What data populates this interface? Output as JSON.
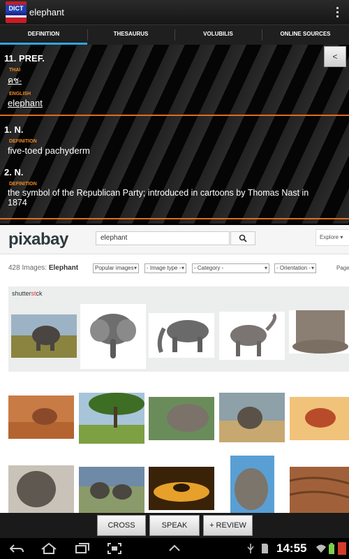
{
  "app": {
    "icon_label": "DICT",
    "title": "elephant"
  },
  "tabs": [
    {
      "label": "DEFINITION",
      "active": true
    },
    {
      "label": "THESAURUS"
    },
    {
      "label": "VOLUBILIS"
    },
    {
      "label": "ONLINE SOURCES"
    }
  ],
  "definitions": {
    "back_label": "<",
    "pref": {
      "sense": "11. PREF.",
      "thai_label": "THAI",
      "thai_value": "คช-",
      "english_label": "ENGLISH",
      "english_value": "elephant"
    },
    "senses": [
      {
        "sense": "1. N.",
        "def_label": "DEFINITION",
        "def": "five-toed pachyderm"
      },
      {
        "sense": "2. N.",
        "def_label": "DEFINITION",
        "def": "the symbol of the Republican Party; introduced in cartoons by Thomas Nast in",
        "def_cont": "1874"
      }
    ]
  },
  "pixabay": {
    "logo": "pixabay",
    "search_value": "elephant",
    "explore_label": "Explore",
    "results_prefix": "428 Images:",
    "results_term": "Elephant",
    "filters": [
      "Popular images",
      "- Image type -",
      "- Category -",
      "- Orientation -"
    ],
    "page_label": "Page",
    "shutter_prefix": "shutter",
    "shutter_accent": "st",
    "shutter_suffix": "ck"
  },
  "buttons": {
    "cross": "CROSS",
    "speak": "SPEAK",
    "review": "+ REVIEW"
  },
  "status": {
    "time": "14:55"
  },
  "colors": {
    "accent_tab": "#33a5df",
    "label_orange": "#f08a24",
    "separator": "#e36b1c"
  },
  "icons": [
    "back-icon",
    "home-icon",
    "recent-apps-icon",
    "screenshot-icon",
    "up-arrow-icon",
    "usb-icon",
    "sd-card-icon",
    "wifi-icon",
    "battery-icon"
  ]
}
